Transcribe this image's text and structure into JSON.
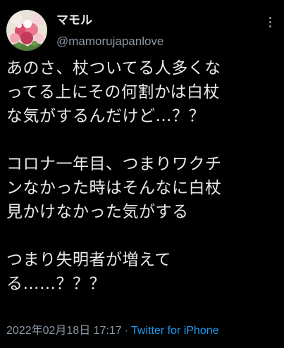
{
  "author": {
    "display_name": "マモル",
    "handle": "@mamorujapanlove"
  },
  "tweet": {
    "paragraphs": [
      {
        "lines": [
          "あのさ、杖ついてる人多くな",
          "ってる上にその何割かは白杖",
          "な気がするんだけど…？？"
        ]
      },
      {
        "lines": [
          "コロナ一年目、つまりワクチ",
          "ンなかった時はそんなに白杖",
          "見かけなかった気がする"
        ]
      },
      {
        "lines": [
          "つまり失明者が増えて",
          "る……？？？"
        ]
      }
    ]
  },
  "meta": {
    "timestamp": "2022年02月18日 17:17",
    "separator": "·",
    "source": "Twitter for iPhone"
  },
  "colors": {
    "background": "#000000",
    "text": "#e7e9ea",
    "secondary": "#8b98a5",
    "link": "#1d9bf0"
  },
  "icons": {
    "avatar": "flower-bouquet-avatar",
    "more": "more-options-icon"
  }
}
